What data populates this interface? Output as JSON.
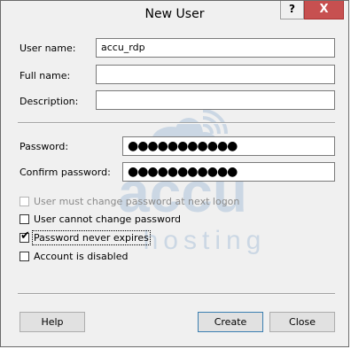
{
  "window": {
    "title": "New User",
    "help_glyph": "?",
    "close_glyph": "X"
  },
  "fields": {
    "user_name": {
      "label": "User name:",
      "value": "accu_rdp"
    },
    "full_name": {
      "label": "Full name:",
      "value": ""
    },
    "description": {
      "label": "Description:",
      "value": ""
    },
    "password": {
      "label": "Password:",
      "value": "●●●●●●●●●●●"
    },
    "confirm_password": {
      "label": "Confirm password:",
      "value": "●●●●●●●●●●●"
    }
  },
  "options": [
    {
      "label": "User must change password at next logon",
      "checked": false,
      "disabled": true
    },
    {
      "label": "User cannot change password",
      "checked": false,
      "disabled": false
    },
    {
      "label": "Password never expires",
      "checked": true,
      "disabled": false
    },
    {
      "label": "Account is disabled",
      "checked": false,
      "disabled": false
    }
  ],
  "buttons": {
    "help": "Help",
    "create": "Create",
    "close": "Close"
  },
  "watermark": {
    "brand": "accu",
    "tagline": "hosting",
    "color": "#2a6db0"
  },
  "colors": {
    "close_button": "#c75050",
    "default_button_border": "#3c7fb1"
  },
  "icons": {
    "check": "✔"
  }
}
